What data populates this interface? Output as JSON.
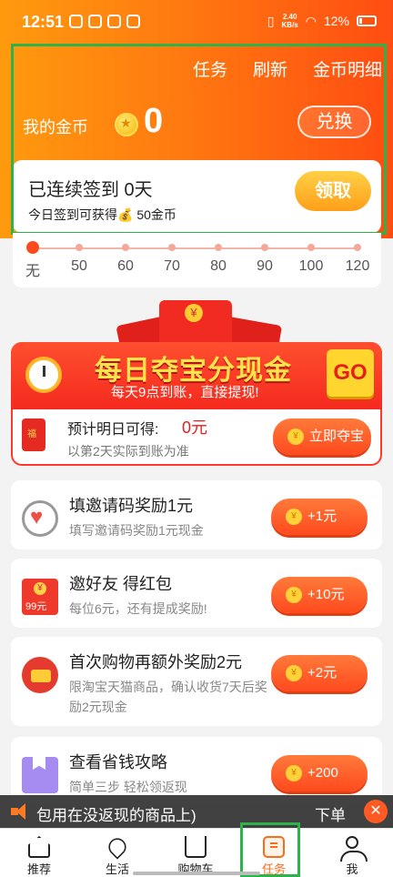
{
  "status_bar": {
    "time": "12:51",
    "network_speed_value": "2.40",
    "network_speed_unit": "KB/s",
    "battery": "12%"
  },
  "header": {
    "links": [
      "任务",
      "刷新",
      "金币明细"
    ],
    "coins_label": "我的金币",
    "coins_value": "0",
    "exchange_label": "兑换"
  },
  "signin": {
    "title": "已连续签到 0天",
    "subtitle": "今日签到可获得💰 50金币",
    "claim_label": "领取",
    "steps": [
      "无",
      "50",
      "60",
      "70",
      "80",
      "90",
      "100",
      "120"
    ],
    "current_step": 0
  },
  "treasure": {
    "title": "每日夺宝分现金",
    "subtitle": "每天9点到账，直接提现!",
    "go_label": "GO",
    "estimate_label": "预计明日可得:",
    "estimate_value": "0元",
    "estimate_note": "以第2天实际到账为准",
    "button_label": "立即夺宝"
  },
  "tasks": [
    {
      "title": "填邀请码奖励1元",
      "subtitle": "填写邀请码奖励1元现金",
      "reward": "+1元",
      "icon": "heart-icon"
    },
    {
      "title": "邀好友 得红包",
      "subtitle": "每位6元，还有提成奖励!",
      "reward": "+10元",
      "icon": "red-envelope-icon"
    },
    {
      "title": "首次购物再额外奖励2元",
      "subtitle": "限淘宝天猫商品，确认收货7天后奖励2元现金",
      "reward": "+2元",
      "icon": "wallet-icon"
    },
    {
      "title": "查看省钱攻略",
      "subtitle": "简单三步 轻松领返现",
      "reward": "+200",
      "icon": "book-icon"
    }
  ],
  "marquee": {
    "text": "包用在没返现的商品上)",
    "text_right": "下单",
    "close_glyph": "✕"
  },
  "tabbar": [
    {
      "label": "推荐",
      "icon": "home-icon"
    },
    {
      "label": "生活",
      "icon": "location-pin-icon"
    },
    {
      "label": "购物车",
      "icon": "cart-icon"
    },
    {
      "label": "任务",
      "icon": "task-icon",
      "active": true
    },
    {
      "label": "我",
      "icon": "user-icon"
    }
  ],
  "colors": {
    "accent": "#ff6a1a",
    "header_start": "#ff9a0e",
    "header_end": "#ff4d12",
    "highlight": "#2cb34a",
    "reward_red": "#e3201b"
  }
}
